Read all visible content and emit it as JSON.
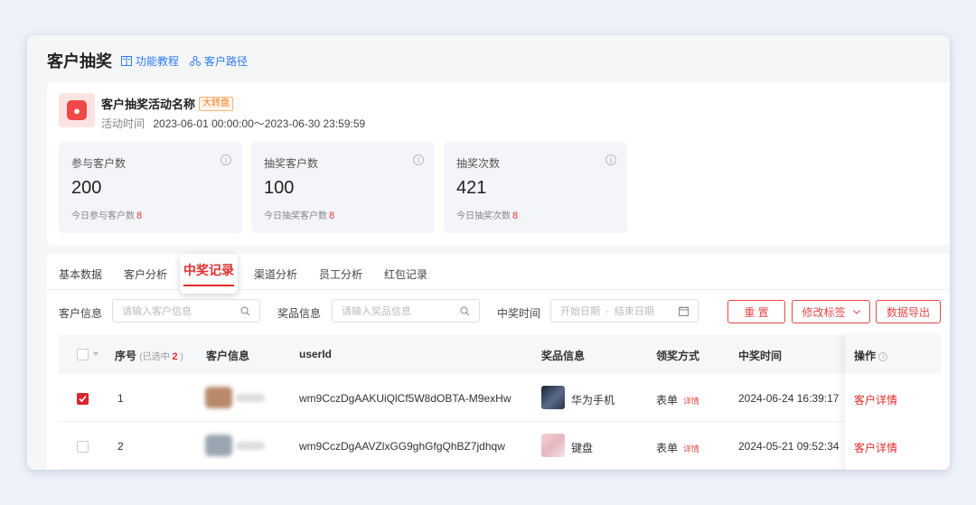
{
  "header": {
    "title": "客户抽奖",
    "links": [
      {
        "label": "功能教程",
        "icon": "book-icon"
      },
      {
        "label": "客户路径",
        "icon": "path-icon"
      }
    ]
  },
  "activity": {
    "icon": "lottery-app-icon",
    "name": "客户抽奖活动名称",
    "badge": "大转盘",
    "time_label": "活动时间",
    "time_value": "2023-06-01 00:00:00～2023-06-30 23:59:59"
  },
  "stats": [
    {
      "label": "参与客户数",
      "value": "200",
      "sub_label": "今日参与客户数",
      "sub_value": "8"
    },
    {
      "label": "抽奖客户数",
      "value": "100",
      "sub_label": "今日抽奖客户数",
      "sub_value": "8"
    },
    {
      "label": "抽奖次数",
      "value": "421",
      "sub_label": "今日抽奖次数",
      "sub_value": "8"
    }
  ],
  "tabs": [
    "基本数据",
    "客户分析",
    "中奖记录",
    "渠道分析",
    "员工分析",
    "红包记录"
  ],
  "active_tab": "中奖记录",
  "filters": {
    "customer_label": "客户信息",
    "customer_placeholder": "请输入客户信息",
    "prize_label": "奖品信息",
    "prize_placeholder": "请输入奖品信息",
    "time_label": "中奖时间",
    "start_placeholder": "开始日期",
    "separator": "-",
    "end_placeholder": "结束日期",
    "reset_button": "重 置",
    "tag_button": "修改标签",
    "export_button": "数据导出"
  },
  "table": {
    "columns": {
      "index": "序号",
      "selected_prefix": "(已选中",
      "selected_count": "2",
      "selected_suffix": ")",
      "customer": "客户信息",
      "userid": "userId",
      "prize": "奖品信息",
      "claim": "领奖方式",
      "win_time": "中奖时间",
      "action": "操作"
    },
    "rows": [
      {
        "checked": true,
        "index": "1",
        "userid": "wm9CczDgAAKUiQlCf5W8dOBTA-M9exHw",
        "prize": "华为手机",
        "claim": "表单",
        "claim_detail": "详情",
        "win_time": "2024-06-24 16:39:17",
        "action": "客户详情"
      },
      {
        "checked": false,
        "index": "2",
        "userid": "wm9CczDgAAVZlxGG9ghGfgQhBZ7jdhqw",
        "prize": "键盘",
        "claim": "表单",
        "claim_detail": "详情",
        "win_time": "2024-05-21 09:52:34",
        "action": "客户详情"
      }
    ]
  },
  "colors": {
    "accent": "#e22d2d",
    "link": "#2f7bff",
    "badge": "#ff7a1a"
  }
}
